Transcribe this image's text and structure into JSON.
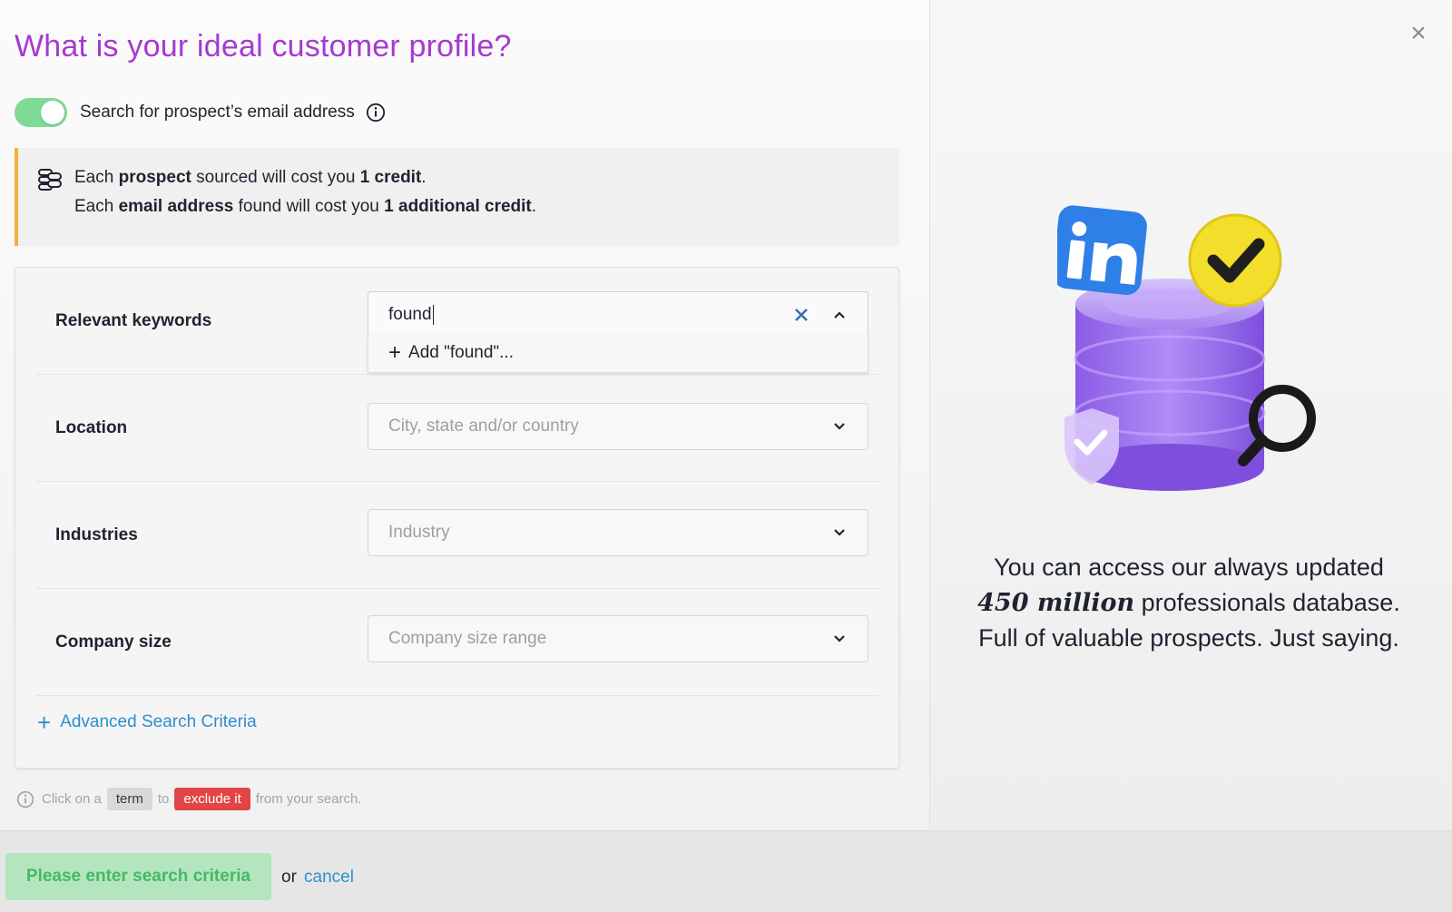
{
  "modal": {
    "title": "What is your ideal customer profile?",
    "close_icon": "close-icon"
  },
  "email_toggle": {
    "label": "Search for prospect’s email address",
    "enabled": true,
    "color": "#7ddb96"
  },
  "credit_notice": {
    "line1": {
      "prefix": "Each ",
      "bold1": "prospect",
      "middle": " sourced will cost you ",
      "bold2": "1 credit",
      "suffix": "."
    },
    "line2": {
      "prefix": "Each ",
      "bold1": "email address",
      "middle": " found will cost you ",
      "bold2": "1 additional credit",
      "suffix": "."
    },
    "accent": "#f2b13d"
  },
  "form": {
    "keywords": {
      "label": "Relevant keywords",
      "value": "found",
      "suggestion": "Add \"found\"..."
    },
    "location": {
      "label": "Location",
      "placeholder": "City, state and/or country"
    },
    "industries": {
      "label": "Industries",
      "placeholder": "Industry"
    },
    "company_size": {
      "label": "Company size",
      "placeholder": "Company size range"
    },
    "advanced_link": "Advanced Search Criteria"
  },
  "hint": {
    "part1": "Click on a",
    "term": "term",
    "part2": "to",
    "exclude": "exclude it",
    "part3": "from your search."
  },
  "footer": {
    "submit_label": "Please enter search criteria",
    "or_text": "or",
    "cancel_label": "cancel"
  },
  "promo": {
    "line1": "You can access our always updated",
    "highlight": "450 million",
    "line2_rest": " professionals database.",
    "line3": "Full of valuable prospects. Just saying."
  },
  "colors": {
    "title": "#a53ad0",
    "link": "#2e8ed0",
    "exclude": "#e24545"
  }
}
